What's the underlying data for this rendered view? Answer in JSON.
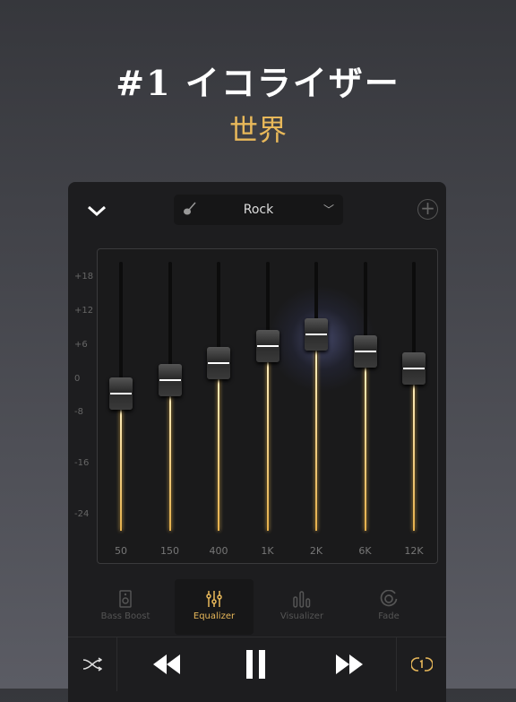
{
  "header": {
    "title": "#1 イコライザー",
    "subtitle": "世界"
  },
  "preset": {
    "name": "Rock",
    "icon": "guitar-icon"
  },
  "eq": {
    "y_labels": [
      "+18",
      "+12",
      "+6",
      "0",
      "-8",
      "-16",
      "-24"
    ],
    "bands": [
      {
        "label": "50",
        "gain_db": -2.5
      },
      {
        "label": "150",
        "gain_db": 0
      },
      {
        "label": "400",
        "gain_db": 3
      },
      {
        "label": "1K",
        "gain_db": 6
      },
      {
        "label": "2K",
        "gain_db": 8
      },
      {
        "label": "6K",
        "gain_db": 5
      },
      {
        "label": "12K",
        "gain_db": 2
      }
    ],
    "range_db": [
      -24,
      18
    ]
  },
  "tabs": [
    {
      "label": "Bass Boost"
    },
    {
      "label": "Equalizer",
      "active": true
    },
    {
      "label": "Visualizer"
    },
    {
      "label": "Fade"
    }
  ],
  "colors": {
    "accent": "#e8b85a",
    "panel": "#1d1d1f"
  }
}
